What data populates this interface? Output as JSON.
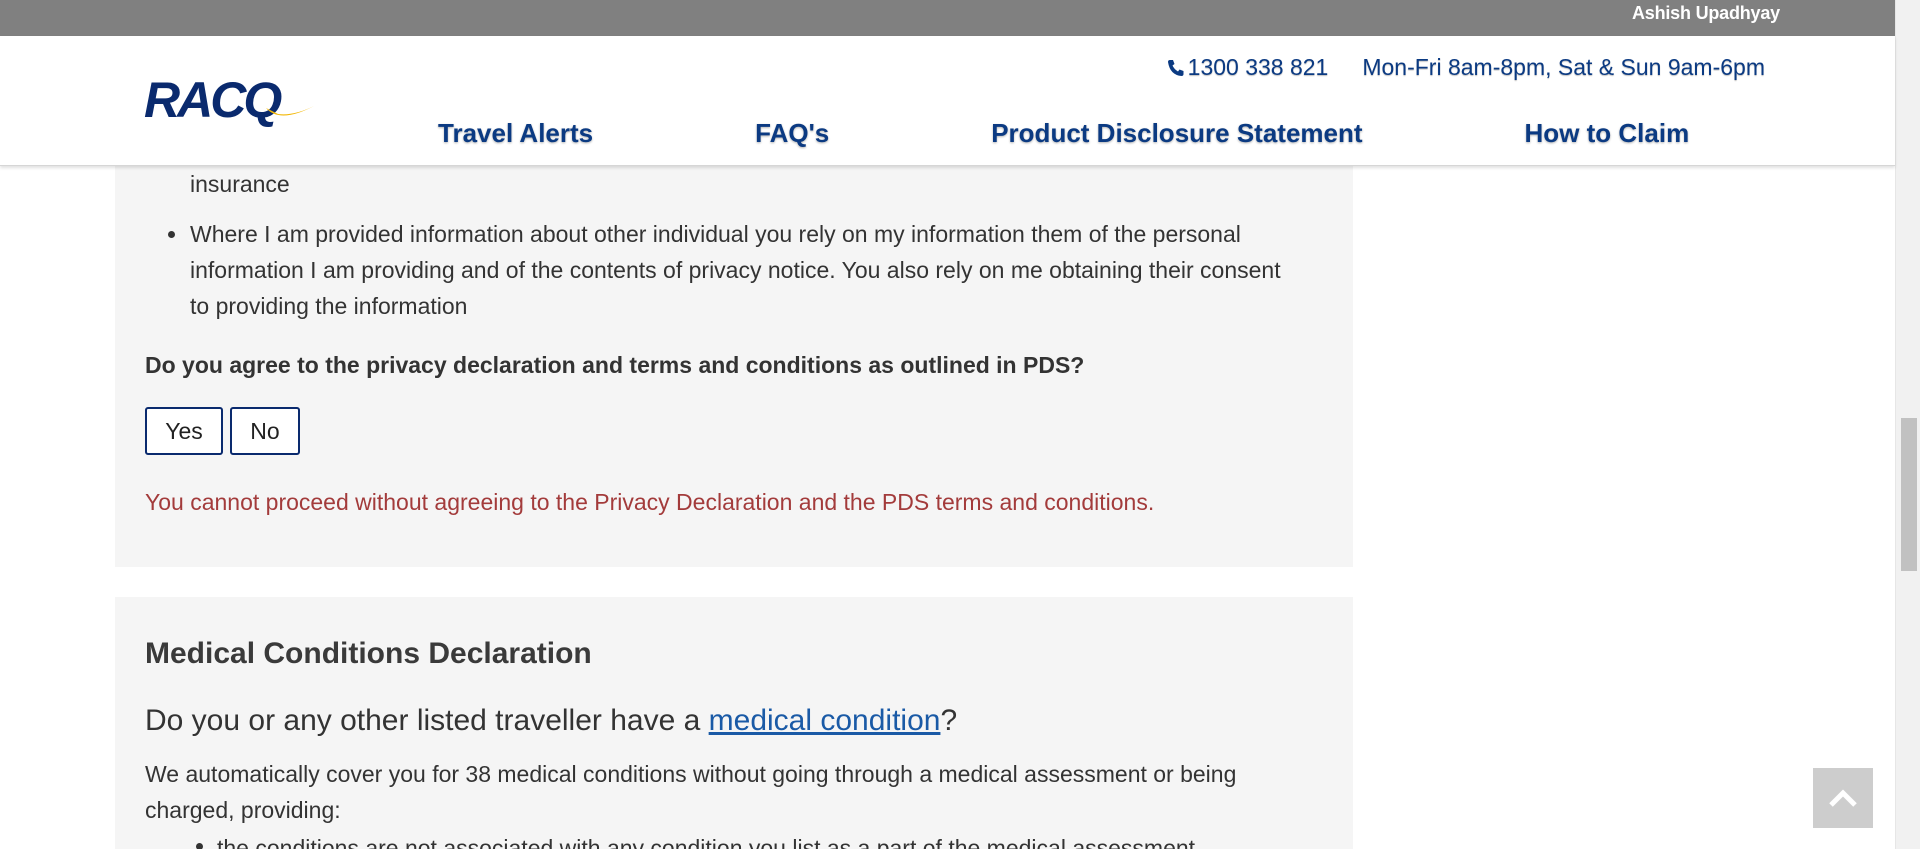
{
  "user_bar": {
    "user_name": "Ashish Upadhyay"
  },
  "header": {
    "logo_text": "RACQ",
    "phone": "1300 338 821",
    "hours": "Mon-Fri 8am-8pm, Sat & Sun 9am-6pm",
    "nav": [
      {
        "label": "Travel Alerts"
      },
      {
        "label": "FAQ's"
      },
      {
        "label": "Product Disclosure Statement"
      },
      {
        "label": "How to Claim"
      }
    ]
  },
  "privacy": {
    "cut_line": "insurance",
    "bullet": "Where I am provided information about other individual you rely on my information them of the personal information I am providing and of the contents of privacy notice. You also rely on me obtaining their consent to providing the information",
    "question": "Do you agree to the privacy declaration and terms and conditions as outlined in PDS?",
    "yes_label": "Yes",
    "no_label": "No",
    "error": "You cannot proceed without agreeing to the Privacy Declaration and the PDS terms and conditions."
  },
  "medical": {
    "title": "Medical Conditions Declaration",
    "question_prefix": "Do you or any other listed traveller have a ",
    "question_link": "medical condition",
    "question_suffix": "?",
    "paragraph": "We automatically cover you for 38 medical conditions without going through a medical assessment or being charged, providing:",
    "bullet": "the conditions are not associated with any condition you list as a part of the medical assessment"
  },
  "colors": {
    "brand_navy": "#0a2a6e",
    "link_blue": "#1a5aa6",
    "error_red": "#a33b3b",
    "top_bar_gray": "#808080"
  },
  "icons": [
    "phone-icon",
    "chevron-up-icon",
    "logo-swoosh"
  ]
}
